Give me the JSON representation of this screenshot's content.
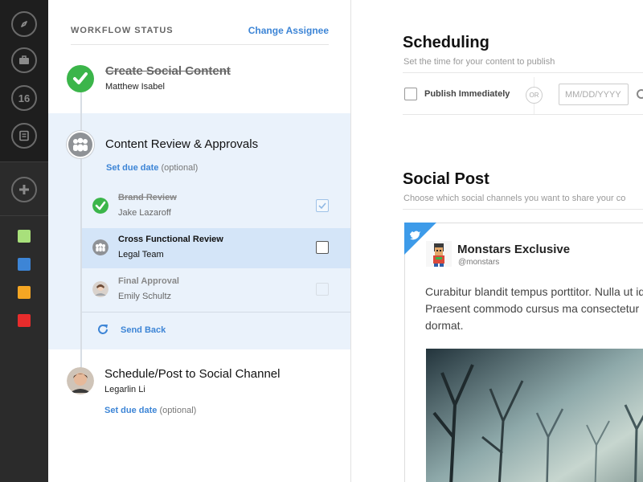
{
  "rail": {
    "icons": [
      "compass-icon",
      "briefcase-icon",
      "calendar-icon",
      "notes-icon",
      "plus-icon"
    ],
    "calendar_day": "16",
    "swatches": [
      "#a8e07b",
      "#3d85d6",
      "#f5a623",
      "#e82c2c"
    ]
  },
  "workflow": {
    "title": "WORKFLOW STATUS",
    "change_assignee": "Change Assignee",
    "steps": [
      {
        "title": "Create Social Content",
        "assignee": "Matthew Isabel",
        "done": true
      },
      {
        "title": "Content Review & Approvals",
        "due_link": "Set due date",
        "due_suffix": "(optional)"
      },
      {
        "title": "Schedule/Post to Social Channel",
        "assignee": "Legarlin Li",
        "due_link": "Set due date",
        "due_suffix": "(optional)"
      }
    ],
    "subtasks": [
      {
        "title": "Brand Review",
        "assignee": "Jake Lazaroff",
        "state": "done",
        "checked": true
      },
      {
        "title": "Cross Functional Review",
        "assignee": "Legal Team",
        "state": "active",
        "checked": false
      },
      {
        "title": "Final Approval",
        "assignee": "Emily Schultz",
        "state": "pending",
        "checked": false
      }
    ],
    "send_back": "Send Back"
  },
  "scheduling": {
    "title": "Scheduling",
    "hint": "Set the time for your content to publish",
    "publish_immediately": "Publish Immediately",
    "or": "OR",
    "date_placeholder": "MM/DD/YYYY"
  },
  "social_post": {
    "title": "Social Post",
    "hint": "Choose which social channels you want to share your co",
    "account_name": "Monstars Exclusive",
    "account_handle": "@monstars",
    "body": "Curabitur blandit tempus porttitor. Nulla ut id elit. Praesent commodo cursus ma consectetur dormat.",
    "accent_color": "#3d9be9"
  }
}
